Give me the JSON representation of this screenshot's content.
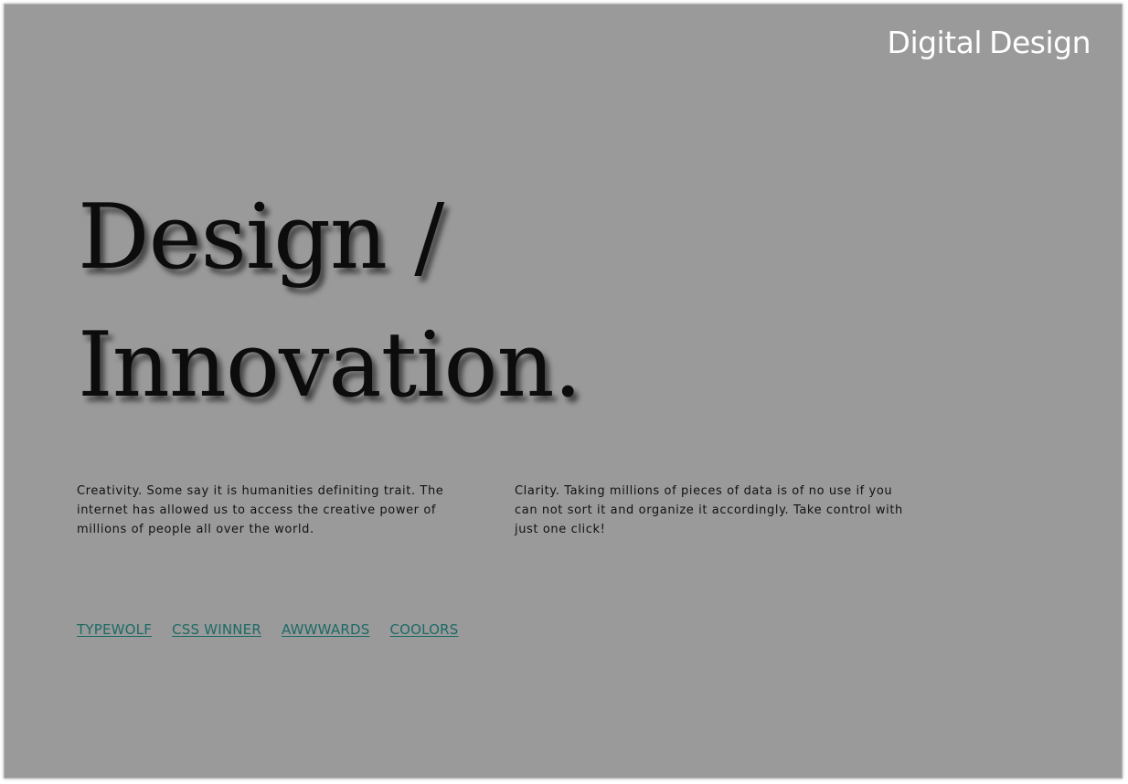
{
  "header": {
    "logo_word1": "Digital",
    "logo_word2": "Design"
  },
  "hero": {
    "line1": "Design /",
    "line2": "Innovation."
  },
  "columns": [
    {
      "text": "Creativity. Some say it is humanities definiting trait. The internet has allowed us to access the creative power of millions of people all over the world."
    },
    {
      "text": "Clarity. Taking millions of pieces of data is of no use if you can not sort it and organize it accordingly. Take control with just one click!"
    }
  ],
  "links": [
    {
      "label": "TYPEWOLF"
    },
    {
      "label": "CSS WINNER"
    },
    {
      "label": "AWWWARDS"
    },
    {
      "label": "COOLORS"
    }
  ],
  "colors": {
    "background": "#9a9a9a",
    "link": "#1c6a66",
    "logo": "#ffffff",
    "heading": "#0c0c0c"
  }
}
